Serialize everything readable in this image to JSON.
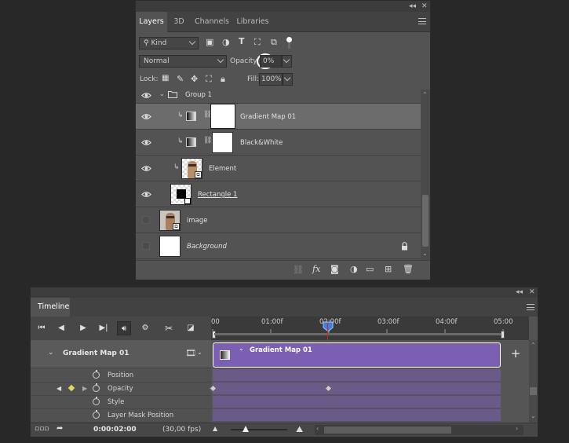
{
  "layers_panel": {
    "tabs": [
      "Layers",
      "3D",
      "Channels",
      "Libraries"
    ],
    "active_tab": "Layers",
    "filter": {
      "kind_label": "Kind"
    },
    "blend_mode": "Normal",
    "opacity_label": "Opacity:",
    "opacity_value": "0%",
    "lock_label": "Lock:",
    "fill_label": "Fill:",
    "fill_value": "100%",
    "layers": [
      {
        "name": "Group 1",
        "type": "group",
        "visible": true
      },
      {
        "name": "Gradient Map 01",
        "type": "adjustment",
        "visible": true,
        "selected": true
      },
      {
        "name": "Black&White",
        "type": "adjustment",
        "visible": true
      },
      {
        "name": "Element",
        "type": "smart-object",
        "visible": true
      },
      {
        "name": "Rectangle 1",
        "type": "shape",
        "visible": true
      },
      {
        "name": "image",
        "type": "smart-object",
        "visible": false
      },
      {
        "name": "Background",
        "type": "background",
        "visible": false,
        "locked": true
      }
    ]
  },
  "timeline": {
    "tab": "Timeline",
    "ruler_labels": [
      "00",
      "01:00f",
      "02:00f",
      "03:00f",
      "04:00f",
      "05:00"
    ],
    "track_name": "Gradient Map 01",
    "clip_name": "Gradient Map 01",
    "properties": [
      "Position",
      "Opacity",
      "Style",
      "Layer Mask Position"
    ],
    "current_time": "0:00:02:00",
    "fps": "(30,00 fps)"
  },
  "colors": {
    "clip": "#7b5fb3",
    "playhead": "#e02020",
    "keyframe_active": "#e6d65a"
  }
}
